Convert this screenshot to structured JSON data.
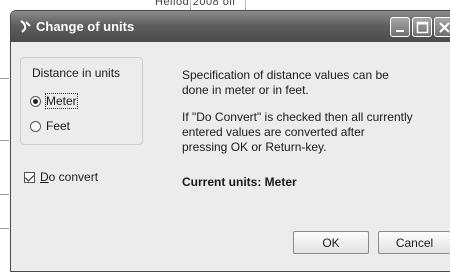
{
  "background": {
    "fragment_text": "Heliod 2008       oil"
  },
  "dialog": {
    "title": "Change of units",
    "group_label": "Distance in units",
    "options": [
      {
        "label": "Meter",
        "selected": true
      },
      {
        "label": "Feet",
        "selected": false
      }
    ],
    "do_convert_label": "Do convert",
    "do_convert_checked": true,
    "info_line1": "Specification of distance values can be",
    "info_line2": "done in meter or in feet.",
    "info_line3": "If \"Do Convert\" is checked then all currently",
    "info_line4": "entered values are converted after",
    "info_line5": "pressing OK or Return-key.",
    "current_units": "Current units: Meter",
    "ok_label": "OK",
    "cancel_label": "Cancel"
  },
  "icons": [
    "app-icon",
    "minimize-icon",
    "maximize-icon",
    "close-icon"
  ]
}
